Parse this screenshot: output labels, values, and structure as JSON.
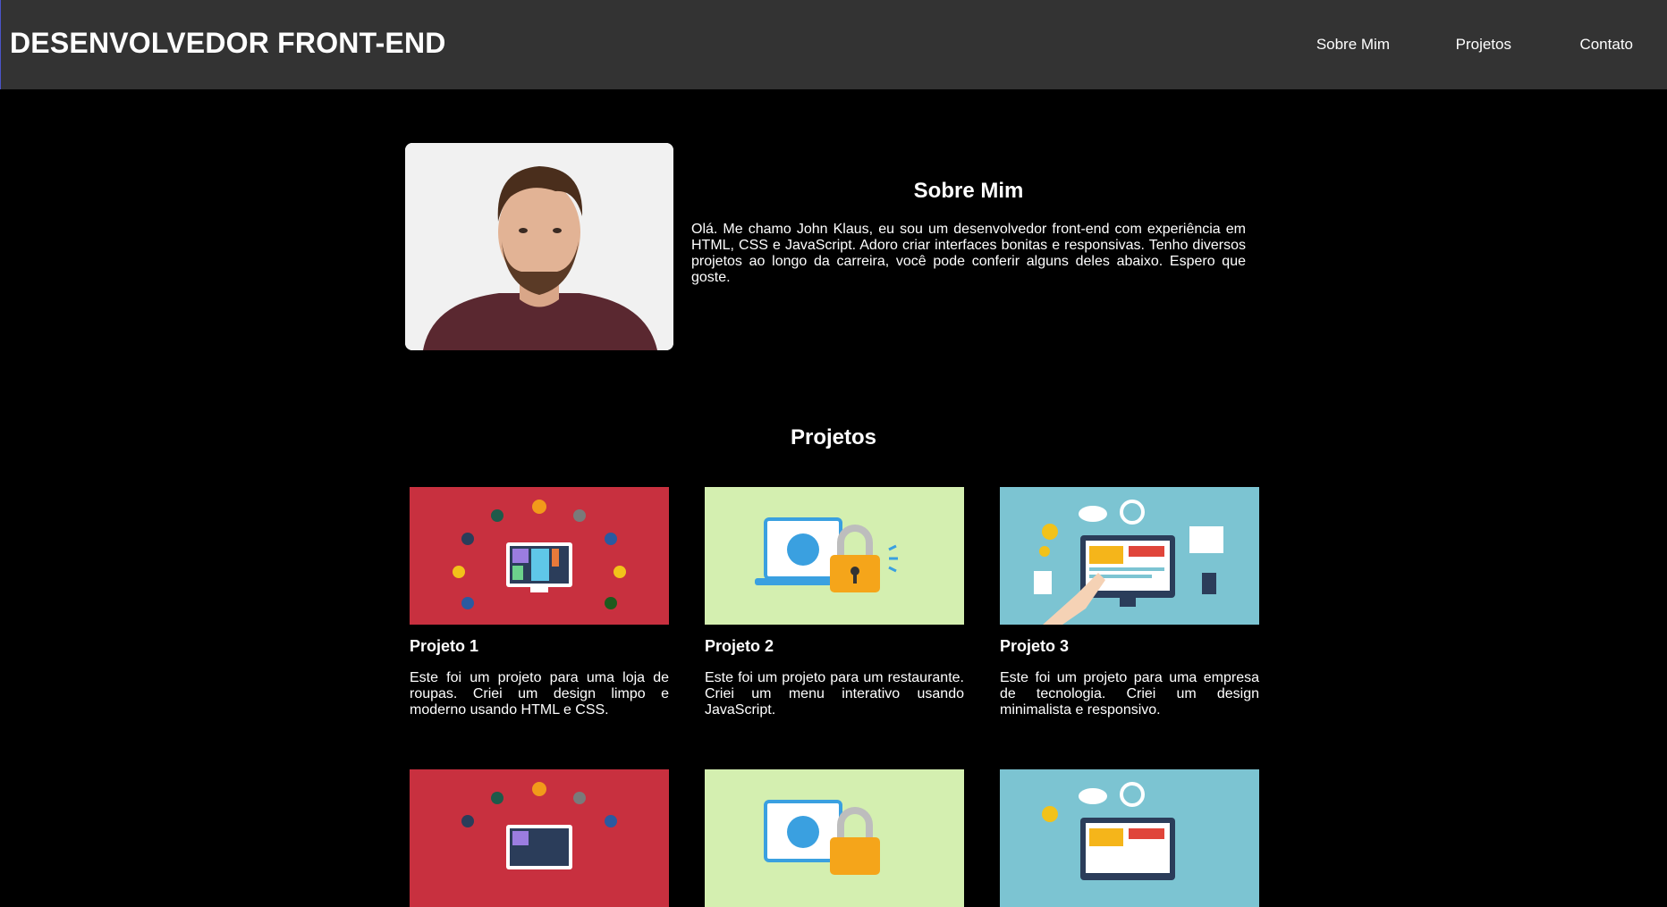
{
  "header": {
    "brand": "DESENVOLVEDOR FRONT-END",
    "nav": [
      "Sobre Mim",
      "Projetos",
      "Contato"
    ]
  },
  "about": {
    "title": "Sobre Mim",
    "text": "Olá. Me chamo John Klaus, eu sou um desenvolvedor front-end com experiência em HTML, CSS e JavaScript. Adoro criar interfaces bonitas e responsivas. Tenho diversos projetos ao longo da carreira, você pode conferir alguns deles abaixo. Espero que goste."
  },
  "projects": {
    "title": "Projetos",
    "items": [
      {
        "title": "Projeto 1",
        "text": "Este foi um projeto para uma loja de roupas. Criei um design limpo e moderno usando HTML e CSS."
      },
      {
        "title": "Projeto 2",
        "text": "Este foi um projeto para um restaurante. Criei um menu interativo usando JavaScript."
      },
      {
        "title": "Projeto 3",
        "text": "Este foi um projeto para uma empresa de tecnologia. Criei um design minimalista e responsivo."
      }
    ]
  },
  "colors": {
    "header_bg": "#333333",
    "page_bg": "#000000",
    "thumb_red": "#c8303f",
    "thumb_green": "#d4efb0",
    "thumb_teal": "#7cc4d2"
  }
}
